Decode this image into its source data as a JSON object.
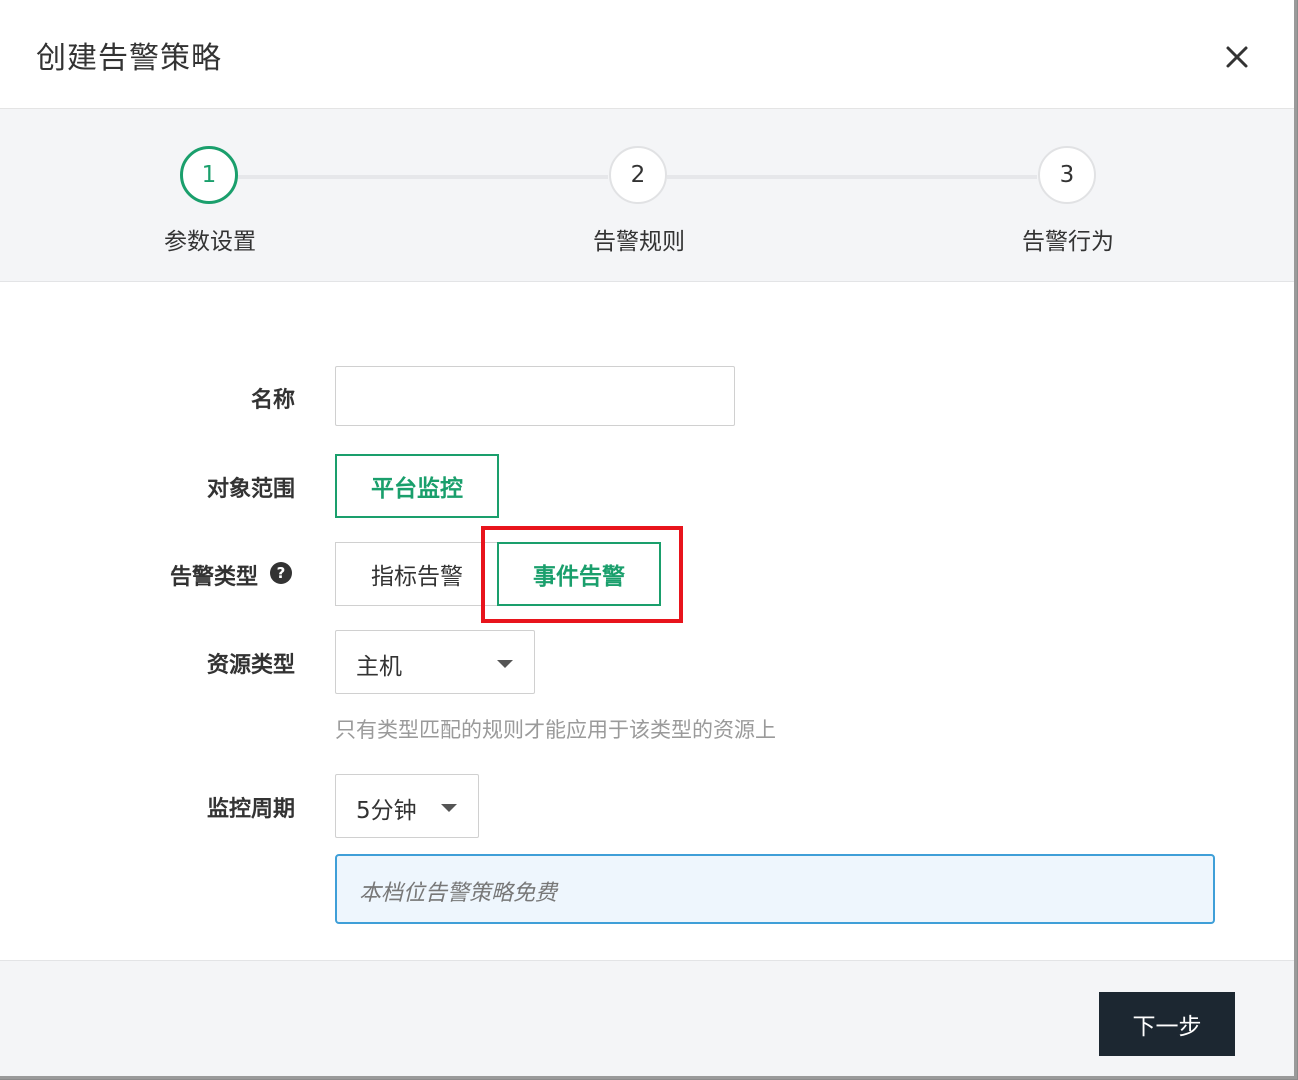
{
  "dialog": {
    "title": "创建告警策略"
  },
  "steps": [
    {
      "number": "1",
      "label": "参数设置",
      "active": true
    },
    {
      "number": "2",
      "label": "告警规则",
      "active": false
    },
    {
      "number": "3",
      "label": "告警行为",
      "active": false
    }
  ],
  "form": {
    "name": {
      "label": "名称",
      "value": "",
      "placeholder": ""
    },
    "scope": {
      "label": "对象范围",
      "selected_option": "平台监控"
    },
    "alert_type": {
      "label": "告警类型",
      "options": [
        "指标告警",
        "事件告警"
      ],
      "selected": "事件告警"
    },
    "resource_type": {
      "label": "资源类型",
      "value": "主机",
      "hint": "只有类型匹配的规则才能应用于该类型的资源上"
    },
    "period": {
      "label": "监控周期",
      "value": "5分钟",
      "notice": "本档位告警策略免费"
    }
  },
  "footer": {
    "next_label": "下一步"
  },
  "colors": {
    "accent": "#1a9f6c",
    "highlight": "#e8141c",
    "notice_border": "#3f9fd8",
    "primary_button": "#1c2731"
  }
}
